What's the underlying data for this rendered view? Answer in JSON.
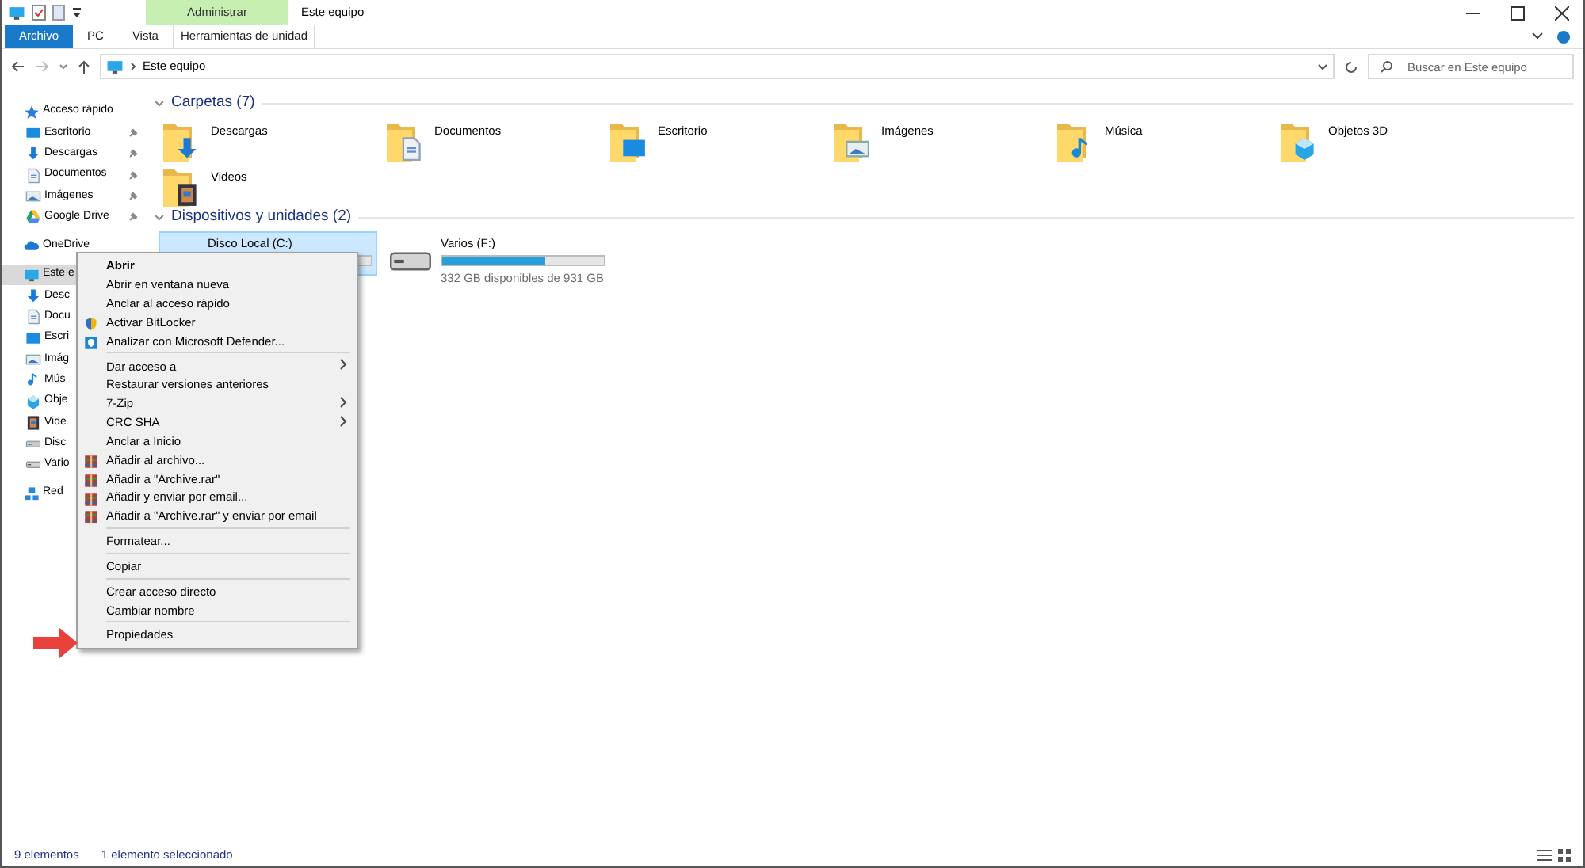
{
  "window": {
    "title": "Este equipo",
    "context_group": "Administrar"
  },
  "ribbon_tabs": [
    {
      "label": "Archivo",
      "kind": "file"
    },
    {
      "label": "PC",
      "kind": "tab"
    },
    {
      "label": "Vista",
      "kind": "tab"
    },
    {
      "label": "Herramientas de unidad",
      "kind": "contextual"
    }
  ],
  "address": {
    "path": "Este equipo"
  },
  "search": {
    "placeholder": "Buscar en Este equipo"
  },
  "sidebar": {
    "items": [
      {
        "label": "Acceso rápido",
        "kind": "star",
        "selected": false,
        "children": [
          {
            "label": "Escritorio",
            "kind": "desktop",
            "selected": false,
            "pinned": true
          },
          {
            "label": "Descargas",
            "kind": "download",
            "selected": false,
            "pinned": true
          },
          {
            "label": "Documentos",
            "kind": "document",
            "selected": false,
            "pinned": true
          },
          {
            "label": "Imágenes",
            "kind": "images",
            "selected": false,
            "pinned": true
          },
          {
            "label": "Google Drive",
            "kind": "gdrive",
            "selected": false,
            "pinned": true
          }
        ]
      },
      {
        "label": "OneDrive",
        "kind": "cloud",
        "selected": false
      },
      {
        "label": "Este e",
        "kind": "pc",
        "selected": true,
        "children": [
          {
            "label": "Desc",
            "kind": "download",
            "selected": false
          },
          {
            "label": "Docu",
            "kind": "document",
            "selected": false
          },
          {
            "label": "Escri",
            "kind": "desktop",
            "selected": false
          },
          {
            "label": "Imág",
            "kind": "images",
            "selected": false
          },
          {
            "label": "Mús",
            "kind": "music",
            "selected": false
          },
          {
            "label": "Obje",
            "kind": "cube",
            "selected": false
          },
          {
            "label": "Vide",
            "kind": "video",
            "selected": false
          },
          {
            "label": "Disc",
            "kind": "disk",
            "selected": false
          },
          {
            "label": "Vario",
            "kind": "drive",
            "selected": false
          }
        ]
      },
      {
        "label": "Red",
        "kind": "network",
        "selected": false
      }
    ]
  },
  "sections": [
    {
      "title": "Carpetas (7)",
      "kind": "folders",
      "expanded": true,
      "items": [
        {
          "label": "Descargas",
          "kind": "download"
        },
        {
          "label": "Documentos",
          "kind": "document"
        },
        {
          "label": "Escritorio",
          "kind": "desktop"
        },
        {
          "label": "Imágenes",
          "kind": "images"
        },
        {
          "label": "Música",
          "kind": "music"
        },
        {
          "label": "Objetos 3D",
          "kind": "cube"
        },
        {
          "label": "Videos",
          "kind": "video"
        }
      ]
    },
    {
      "title": "Dispositivos y unidades (2)",
      "kind": "drives",
      "expanded": true,
      "items": [
        {
          "label": "Disco Local (C:)",
          "selected": true
        },
        {
          "label": "Varios (F:)",
          "kind": "drive",
          "selected": false,
          "level": 0.64,
          "reading": "332 GB disponibles de 931 GB"
        }
      ]
    }
  ],
  "context_menu": {
    "items": [
      {
        "kind": "item",
        "label": "Abrir",
        "default": true
      },
      {
        "kind": "item",
        "label": "Abrir en ventana nueva",
        "default": false
      },
      {
        "kind": "item",
        "label": "Anclar al acceso rápido",
        "default": false
      },
      {
        "kind": "shield",
        "label": "Activar BitLocker",
        "default": false
      },
      {
        "kind": "defender",
        "label": "Analizar con Microsoft Defender...",
        "default": false
      },
      {
        "kind": "separator"
      },
      {
        "kind": "item",
        "label": "Dar acceso a",
        "default": false,
        "submenu": true
      },
      {
        "kind": "item",
        "label": "Restaurar versiones anteriores",
        "default": false
      },
      {
        "kind": "item",
        "label": "7-Zip",
        "default": false,
        "submenu": true
      },
      {
        "kind": "item",
        "label": "CRC SHA",
        "default": false,
        "submenu": true
      },
      {
        "kind": "item",
        "label": "Anclar a Inicio",
        "default": false
      },
      {
        "kind": "archive",
        "label": "Añadir al archivo...",
        "default": false
      },
      {
        "kind": "archive",
        "label": "Añadir a \"Archive.rar\"",
        "default": false
      },
      {
        "kind": "archive",
        "label": "Añadir y enviar por email...",
        "default": false
      },
      {
        "kind": "archive",
        "label": "Añadir a \"Archive.rar\" y enviar por email",
        "default": false
      },
      {
        "kind": "separator"
      },
      {
        "kind": "item",
        "label": "Formatear...",
        "default": false
      },
      {
        "kind": "separator"
      },
      {
        "kind": "item",
        "label": "Copiar",
        "default": false
      },
      {
        "kind": "separator"
      },
      {
        "kind": "item",
        "label": "Crear acceso directo",
        "default": false
      },
      {
        "kind": "item",
        "label": "Cambiar nombre",
        "default": false
      },
      {
        "kind": "separator"
      },
      {
        "kind": "item",
        "label": "Propiedades",
        "default": false
      }
    ]
  },
  "status_bar": {
    "count": "9 elementos",
    "selection": "1 elemento seleccionado"
  }
}
